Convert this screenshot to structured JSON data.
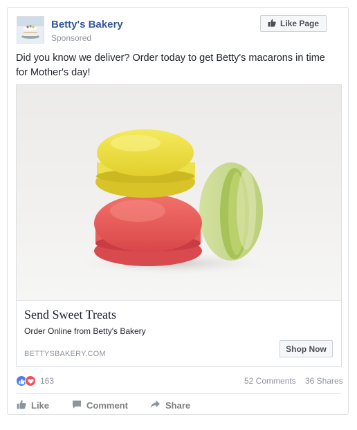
{
  "post": {
    "page_name": "Betty's Bakery",
    "sponsored": "Sponsored",
    "like_page_label": "Like Page",
    "text": "Did you know we deliver? Order today to get Betty's macarons in time for Mother's day!"
  },
  "link": {
    "title": "Send Sweet Treats",
    "description": "Order Online from Betty's Bakery",
    "domain": "BETTYSBAKERY.COM",
    "cta_label": "Shop Now"
  },
  "engagement": {
    "reaction_count": "163",
    "comments": "52 Comments",
    "shares": "36 Shares"
  },
  "actions": {
    "like": "Like",
    "comment": "Comment",
    "share": "Share"
  },
  "icons": {
    "like_page": "thumbs-up-icon",
    "like_reaction": "thumbs-up-icon",
    "love_reaction": "heart-icon",
    "comment": "comment-icon",
    "share": "share-arrow-icon"
  },
  "colors": {
    "page_name": "#365899",
    "like_reaction": "#4a7eef",
    "love_reaction": "#f0505b",
    "muted_text": "#90949c"
  }
}
